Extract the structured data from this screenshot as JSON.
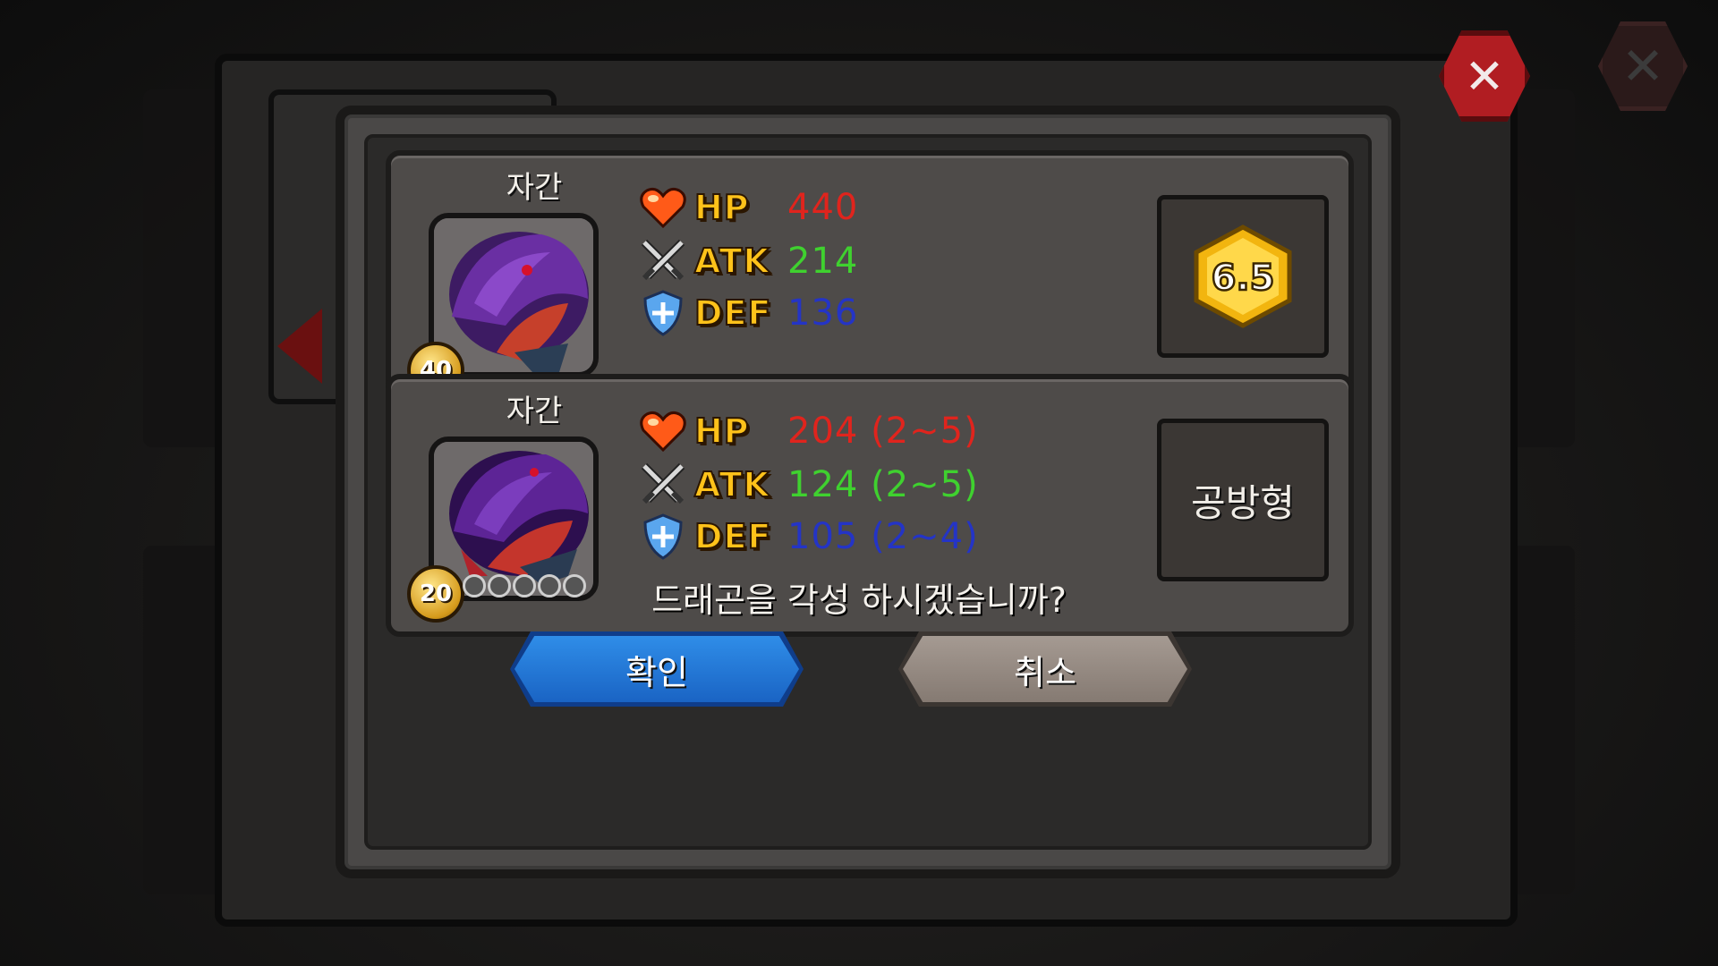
{
  "colors": {
    "hp": "#e0241d",
    "atk": "#3fd12f",
    "def": "#2434c6",
    "confirm": "#1a64c4",
    "cancel": "#857a72",
    "close": "#b11d22"
  },
  "dialog": {
    "close_icon": "close-icon",
    "cards": [
      {
        "name": "자간",
        "level": "40",
        "stats": [
          {
            "icon": "heart-icon",
            "label": "HP",
            "value": "440"
          },
          {
            "icon": "crossed-swords-icon",
            "label": "ATK",
            "value": "214"
          },
          {
            "icon": "shield-icon",
            "label": "DEF",
            "value": "136"
          }
        ],
        "grade": "6.5"
      },
      {
        "name": "자간",
        "level": "20",
        "stars_filled": 0,
        "stars_total": 5,
        "stats": [
          {
            "icon": "heart-icon",
            "label": "HP",
            "value": "204 (2~5)"
          },
          {
            "icon": "crossed-swords-icon",
            "label": "ATK",
            "value": "124 (2~5)"
          },
          {
            "icon": "shield-icon",
            "label": "DEF",
            "value": "105 (2~4)"
          }
        ],
        "type": "공방형"
      }
    ],
    "prompt": "드래곤을 각성 하시겠습니까?",
    "confirm_label": "확인",
    "cancel_label": "취소"
  }
}
